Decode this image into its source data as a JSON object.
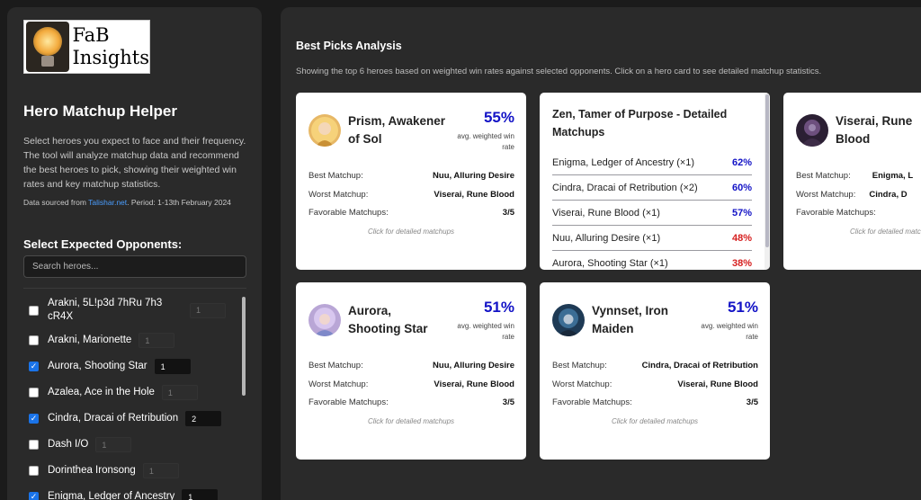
{
  "sidebar": {
    "logo_line1": "FaB",
    "logo_line2": "Insights",
    "title": "Hero Matchup Helper",
    "description": "Select heroes you expect to face and their frequency. The tool will analyze matchup data and recommend the best heroes to pick, showing their weighted win rates and key matchup statistics.",
    "source_prefix": "Data sourced from ",
    "source_link": "Talishar.net",
    "source_suffix": ". Period: 1-13th February 2024",
    "opponents_title": "Select Expected Opponents:",
    "search_placeholder": "Search heroes...",
    "heroes": [
      {
        "name": "Arakni, 5L!p3d 7hRu 7h3 cR4X",
        "checked": false,
        "qty": "1"
      },
      {
        "name": "Arakni, Marionette",
        "checked": false,
        "qty": "1"
      },
      {
        "name": "Aurora, Shooting Star",
        "checked": true,
        "qty": "1"
      },
      {
        "name": "Azalea, Ace in the Hole",
        "checked": false,
        "qty": "1"
      },
      {
        "name": "Cindra, Dracai of Retribution",
        "checked": true,
        "qty": "2"
      },
      {
        "name": "Dash I/O",
        "checked": false,
        "qty": "1"
      },
      {
        "name": "Dorinthea Ironsong",
        "checked": false,
        "qty": "1"
      },
      {
        "name": "Enigma, Ledger of Ancestry",
        "checked": true,
        "qty": "1"
      }
    ]
  },
  "main": {
    "title": "Best Picks Analysis",
    "subtitle": "Showing the top 6 heroes based on weighted win rates against selected opponents. Click on a hero card to see detailed matchup statistics.",
    "labels": {
      "best": "Best Matchup:",
      "worst": "Worst Matchup:",
      "favorable": "Favorable Matchups:",
      "click": "Click for detailed matchups"
    },
    "cards": [
      {
        "name": "Prism, Awakener of Sol",
        "rate": "55%",
        "rate_label": "avg. weighted win rate",
        "best": "Nuu, Alluring Desire",
        "worst": "Viserai, Rune Blood",
        "favorable": "3/5"
      },
      {
        "name": "Viserai, Rune Blood",
        "rate": "",
        "rate_label": "",
        "best": "Enigma, L",
        "worst": "Cindra, D",
        "favorable": ""
      },
      {
        "name": "Aurora, Shooting Star",
        "rate": "51%",
        "rate_label": "avg. weighted win rate",
        "best": "Nuu, Alluring Desire",
        "worst": "Viserai, Rune Blood",
        "favorable": "3/5"
      },
      {
        "name": "Vynnset, Iron Maiden",
        "rate": "51%",
        "rate_label": "avg. weighted win rate",
        "best": "Cindra, Dracai of Retribution",
        "worst": "Viserai, Rune Blood",
        "favorable": "3/5"
      }
    ],
    "detail": {
      "title": "Zen, Tamer of Purpose - Detailed Matchups",
      "rows": [
        {
          "opponent": "Enigma, Ledger of Ancestry (×1)",
          "pct": "62%",
          "color": "#1313c6"
        },
        {
          "opponent": "Cindra, Dracai of Retribution (×2)",
          "pct": "60%",
          "color": "#1313c6"
        },
        {
          "opponent": "Viserai, Rune Blood (×1)",
          "pct": "57%",
          "color": "#1313c6"
        },
        {
          "opponent": "Nuu, Alluring Desire (×1)",
          "pct": "48%",
          "color": "#d62020"
        },
        {
          "opponent": "Aurora, Shooting Star (×1)",
          "pct": "38%",
          "color": "#d62020"
        }
      ]
    }
  }
}
